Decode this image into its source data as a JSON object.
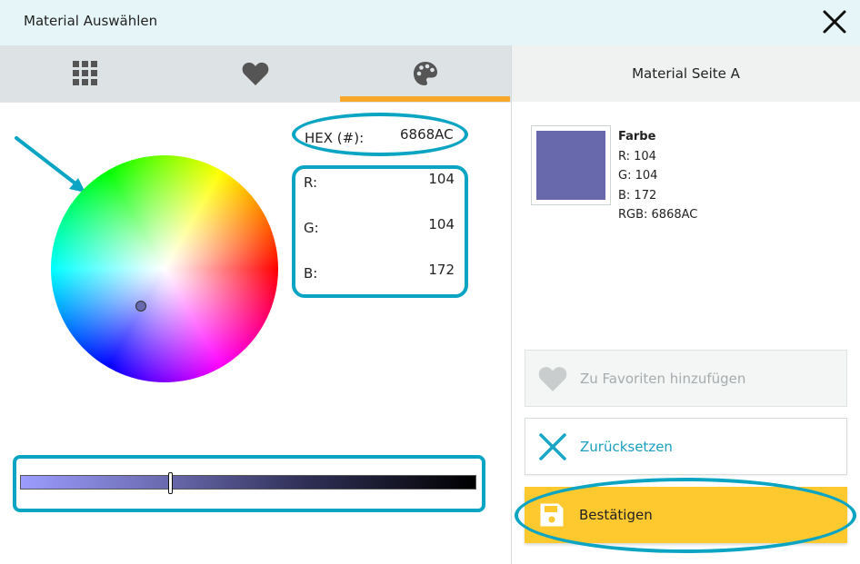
{
  "window": {
    "title": "Material Auswählen"
  },
  "tabs": [
    {
      "name": "grid",
      "icon": "grid-icon"
    },
    {
      "name": "favorites",
      "icon": "heart-icon"
    },
    {
      "name": "palette",
      "icon": "palette-icon",
      "active": true
    }
  ],
  "right_panel": {
    "title": "Material Seite A"
  },
  "color": {
    "hex_label": "HEX (#):",
    "hex_value": "6868AC",
    "r_label": "R:",
    "r_value": "104",
    "g_label": "G:",
    "g_value": "104",
    "b_label": "B:",
    "b_value": "172"
  },
  "brightness_slider": {
    "value_fraction": 0.33
  },
  "preview": {
    "swatch_color": "#6868ac",
    "heading": "Farbe",
    "r_line": "R: 104",
    "g_line": "G: 104",
    "b_line": "B: 172",
    "rgb_line": "RGB: 6868AC"
  },
  "buttons": {
    "favorite": "Zu Favoriten hinzufügen",
    "reset": "Zurücksetzen",
    "confirm": "Bestätigen"
  },
  "colors": {
    "accent": "#0ba5c3",
    "tab_indicator": "#f7a82b",
    "confirm_bg": "#fec82f",
    "titlebar_bg": "#e6f6f8"
  }
}
